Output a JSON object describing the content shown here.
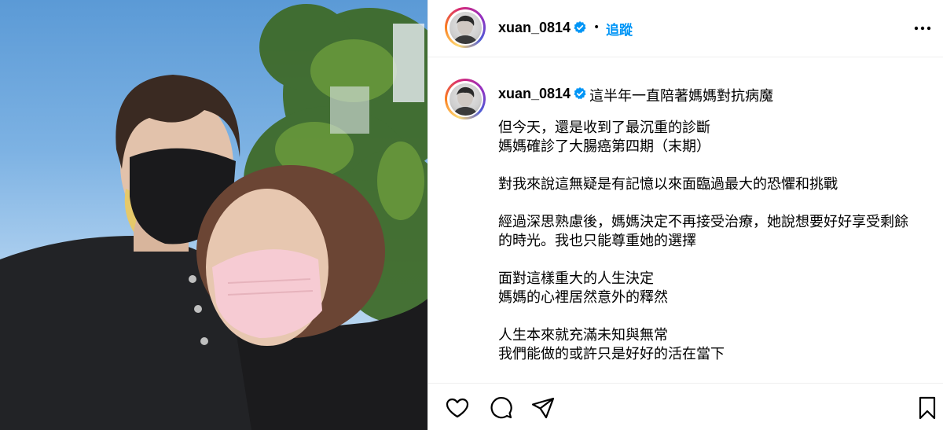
{
  "header": {
    "username": "xuan_0814",
    "separator": "•",
    "follow_label": "追蹤",
    "more_icon": "more-horizontal-icon",
    "verified_icon": "verified-badge-icon"
  },
  "caption": {
    "username": "xuan_0814",
    "first_line": "這半年一直陪著媽媽對抗病魔",
    "lines": [
      "但今天，還是收到了最沉重的診斷",
      "媽媽確診了大腸癌第四期（末期）",
      "",
      "對我來說這無疑是有記憶以來面臨過最大的恐懼和挑戰",
      "",
      "經過深思熟慮後，媽媽決定不再接受治療，她說想要好好享受剩餘",
      "的時光。我也只能尊重她的選擇",
      "",
      "面對這樣重大的人生決定",
      "媽媽的心裡居然意外的釋然",
      "",
      "人生本來就充滿未知與無常",
      "我們能做的或許只是好好的活在當下"
    ]
  },
  "actions": {
    "like_icon": "heart-icon",
    "comment_icon": "comment-icon",
    "share_icon": "share-icon",
    "save_icon": "bookmark-icon"
  },
  "colors": {
    "follow": "#0095f6",
    "verified": "#0095f6",
    "border": "#efefef"
  }
}
